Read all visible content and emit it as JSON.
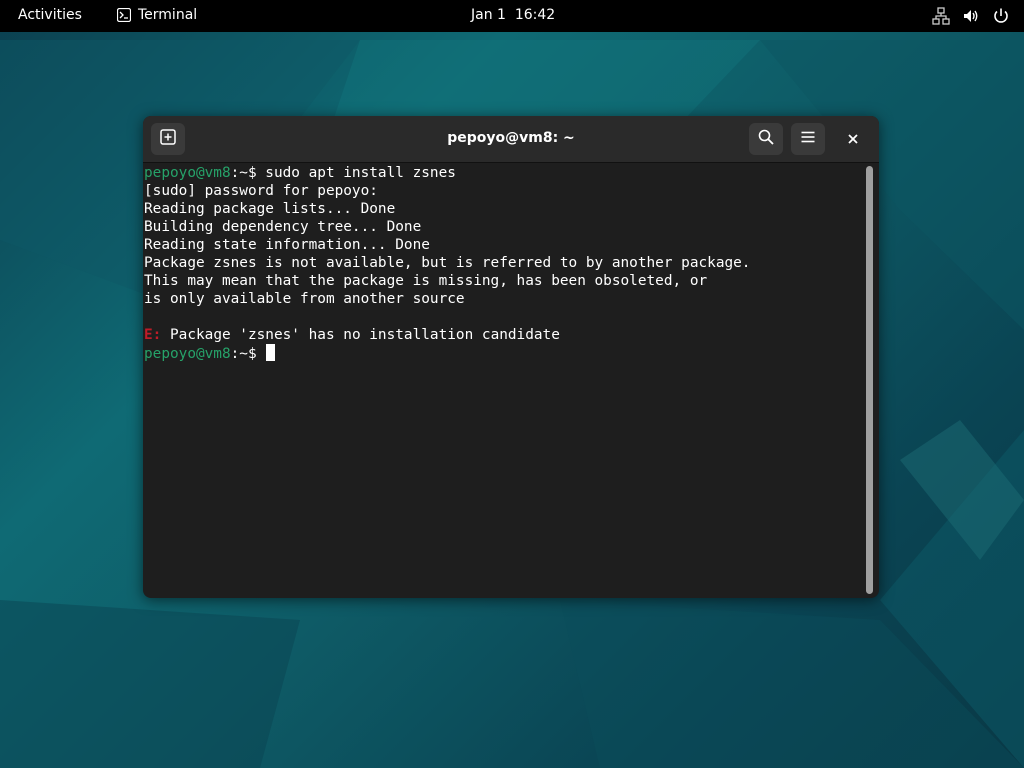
{
  "topbar": {
    "activities": "Activities",
    "app_name": "Terminal",
    "clock": "Jan 1  16:42",
    "icons": [
      "network-icon",
      "volume-icon",
      "power-icon"
    ]
  },
  "window": {
    "title": "pepoyo@vm8: ~",
    "buttons": {
      "new_tab": "new-tab-icon",
      "search": "search-icon",
      "menu": "hamburger-menu-icon",
      "close": "close-icon"
    }
  },
  "terminal": {
    "prompt_user": "pepoyo@vm8",
    "prompt_path": ":~$ ",
    "lines": [
      "sudo apt install zsnes",
      "[sudo] password for pepoyo:",
      "Reading package lists... Done",
      "Building dependency tree... Done",
      "Reading state information... Done",
      "Package zsnes is not available, but is referred to by another package.",
      "This may mean that the package is missing, has been obsoleted, or",
      "is only available from another source",
      "",
      "Package 'zsnes' has no installation candidate"
    ],
    "error_prefix": "E:",
    "colors": {
      "background": "#1e1e1e",
      "prompt": "#26a269",
      "error": "#c01c28",
      "text": "#ffffff"
    }
  }
}
